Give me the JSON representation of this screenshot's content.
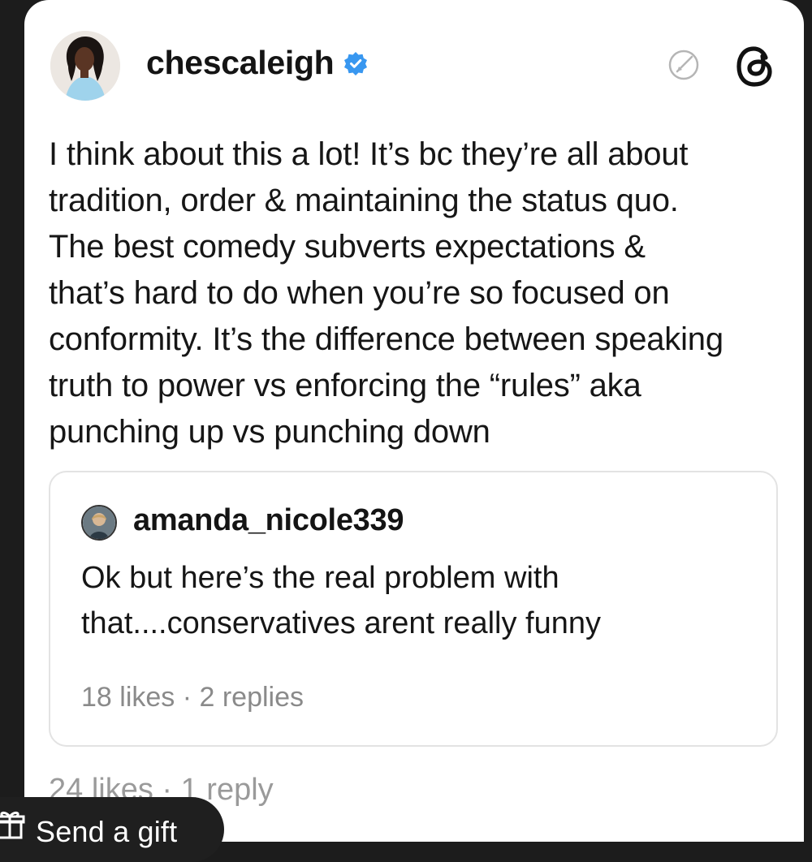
{
  "post": {
    "username": "chescaleigh",
    "text": "I think about this a lot! It’s bc they’re all about\ntradition, order & maintaining the status quo.\nThe best comedy subverts expectations &\nthat’s hard to do when you’re so focused on\nconformity. It’s the difference between speaking\ntruth to power vs enforcing the “rules” aka\npunching up vs punching down",
    "stats": "24 likes · 1 reply"
  },
  "quote": {
    "username": "amanda_nicole339",
    "text": "Ok but here’s the real problem with\nthat....conservatives arent really funny",
    "stats": "18 likes · 2 replies"
  },
  "overlay": {
    "gift_label": "Send a gift"
  },
  "icons": {
    "verified": "verified-badge-icon",
    "edit": "edit-icon",
    "threads": "threads-logo-icon",
    "gift": "gift-icon"
  },
  "colors": {
    "verified": "#3897f0",
    "muted_text": "#8a8a8a"
  }
}
